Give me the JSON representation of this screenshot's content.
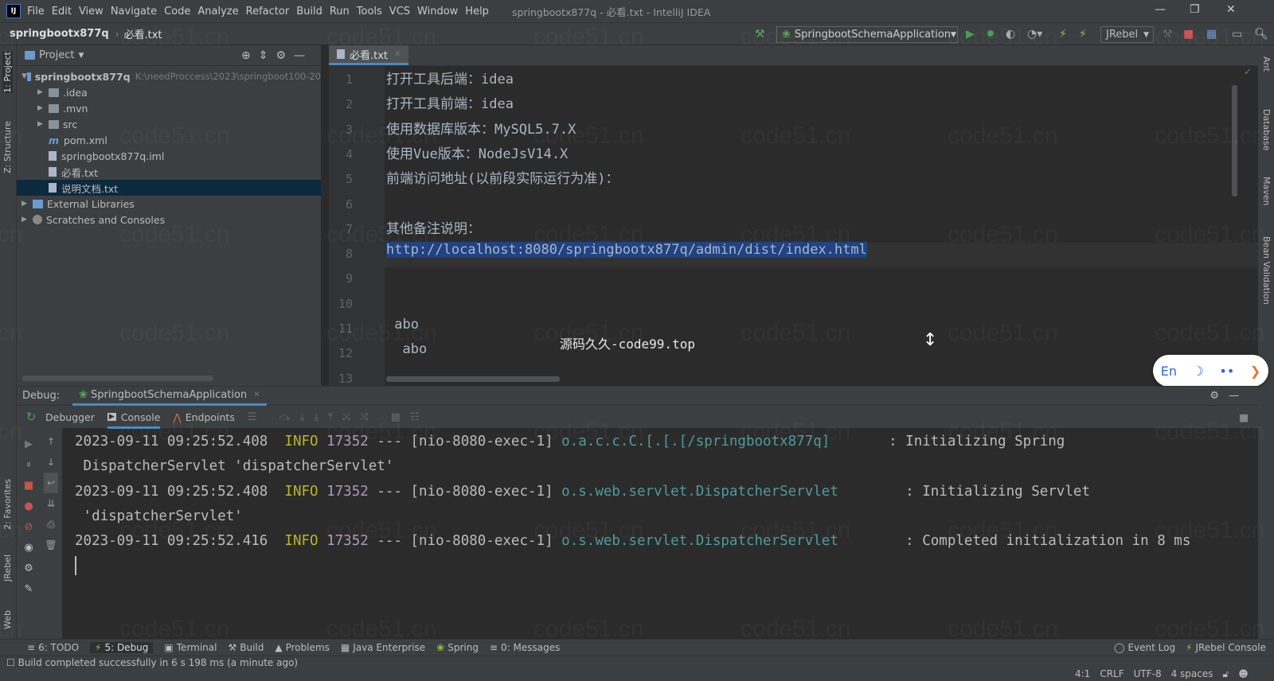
{
  "window": {
    "title": "springbootx877q - 必看.txt - IntelliJ IDEA",
    "logo": "IJ"
  },
  "menu": [
    "File",
    "Edit",
    "View",
    "Navigate",
    "Code",
    "Analyze",
    "Refactor",
    "Build",
    "Run",
    "Tools",
    "VCS",
    "Window",
    "Help"
  ],
  "breadcrumb": {
    "project": "springbootx877q",
    "file": "必看.txt"
  },
  "toolbar": {
    "run_config": "SpringbootSchemaApplication",
    "jrebel": "JRebel"
  },
  "left_stripe": {
    "project": "1: Project",
    "structure": "Z: Structure",
    "favorites": "2: Favorites",
    "jrebel": "JRebel",
    "web": "Web"
  },
  "right_stripe": {
    "ant": "Ant",
    "database": "Database",
    "maven": "Maven",
    "bean": "Bean Validation"
  },
  "project_panel": {
    "title": "Project",
    "tree": [
      {
        "label": "springbootx877q",
        "path": "K:\\needProccess\\2023\\springboot100-20",
        "depth": 0,
        "arrow": "▼",
        "type": "folder-blue",
        "bold": true
      },
      {
        "label": ".idea",
        "depth": 1,
        "arrow": "▶",
        "type": "folder"
      },
      {
        "label": ".mvn",
        "depth": 1,
        "arrow": "▶",
        "type": "folder"
      },
      {
        "label": "src",
        "depth": 1,
        "arrow": "▶",
        "type": "folder"
      },
      {
        "label": "pom.xml",
        "depth": 1,
        "arrow": "",
        "type": "maven"
      },
      {
        "label": "springbootx877q.iml",
        "depth": 1,
        "arrow": "",
        "type": "file"
      },
      {
        "label": "必看.txt",
        "depth": 1,
        "arrow": "",
        "type": "file"
      },
      {
        "label": "说明文档.txt",
        "depth": 1,
        "arrow": "",
        "type": "file",
        "selected": true
      },
      {
        "label": "External Libraries",
        "depth": 0,
        "arrow": "▶",
        "type": "lib"
      },
      {
        "label": "Scratches and Consoles",
        "depth": 0,
        "arrow": "▶",
        "type": "scratch"
      }
    ]
  },
  "editor": {
    "tab": "必看.txt",
    "lines": [
      "打开工具后端：idea",
      "打开工具前端：idea",
      "使用数据库版本：MySQL5.7.X",
      "使用Vue版本：NodeJsV14.X",
      "前端访问地址(以前段实际运行为准)：",
      "",
      "其他备注说明：",
      "http://localhost:8080/springbootx877q/admin/dist/index.html",
      "",
      "",
      " abo",
      "  abo",
      ""
    ],
    "overlay_text": "源码久久-code99.top"
  },
  "debug": {
    "label": "Debug:",
    "session": "SpringbootSchemaApplication",
    "tabs": [
      "Debugger",
      "Console",
      "Endpoints"
    ],
    "log": [
      {
        "ts": "2023-09-11 09:25:52.408",
        "level": "INFO",
        "pid": "17352",
        "sep": "---",
        "thread": "[nio-8080-exec-1]",
        "logger": "o.a.c.c.C.[.[.[/springbootx877q]      ",
        "msg": ": Initializing Spring",
        "cont": " DispatcherServlet 'dispatcherServlet'"
      },
      {
        "ts": "2023-09-11 09:25:52.408",
        "level": "INFO",
        "pid": "17352",
        "sep": "---",
        "thread": "[nio-8080-exec-1]",
        "logger": "o.s.web.servlet.DispatcherServlet       ",
        "msg": ": Initializing Servlet",
        "cont": " 'dispatcherServlet'"
      },
      {
        "ts": "2023-09-11 09:25:52.416",
        "level": "INFO",
        "pid": "17352",
        "sep": "---",
        "thread": "[nio-8080-exec-1]",
        "logger": "o.s.web.servlet.DispatcherServlet       ",
        "msg": ": Completed initialization in 8 ms",
        "cont": ""
      }
    ]
  },
  "bottom_tools": [
    "6: TODO",
    "5: Debug",
    "Terminal",
    "Build",
    "Problems",
    "Java Enterprise",
    "Spring",
    "0: Messages"
  ],
  "bottom_right": {
    "event_log": "Event Log",
    "jrebel_console": "JRebel Console"
  },
  "status": {
    "message": "Build completed successfully in 6 s 198 ms (a minute ago)",
    "position": "4:1",
    "line_sep": "CRLF",
    "encoding": "UTF-8",
    "indent": "4 spaces"
  },
  "lang_widget": {
    "label": "En"
  },
  "watermark": "code51.cn",
  "colors": {
    "accent": "#4a88c7",
    "selection": "#214283",
    "info": "#bbb529",
    "logger": "#4e9a9a"
  }
}
